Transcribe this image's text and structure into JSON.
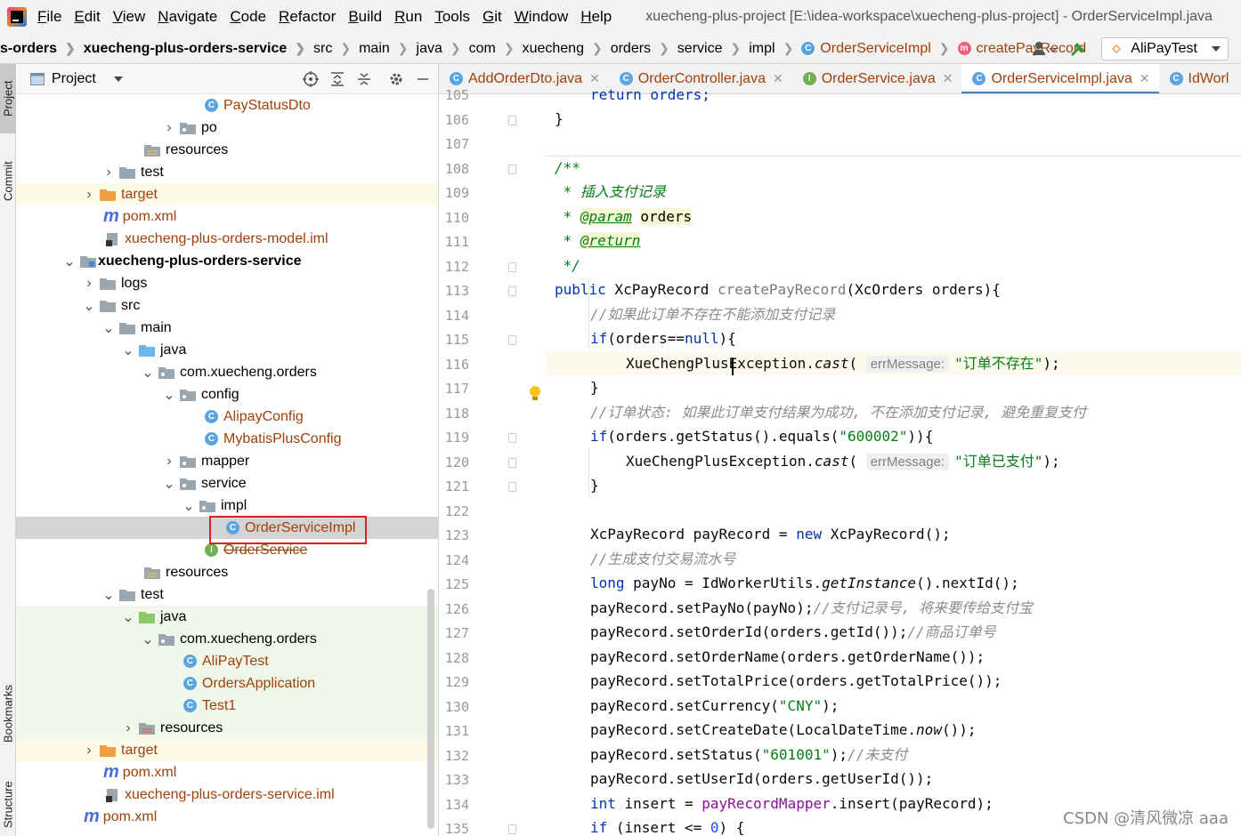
{
  "window": {
    "title": "xuecheng-plus-project [E:\\idea-workspace\\xuecheng-plus-project] - OrderServiceImpl.java"
  },
  "menu": [
    {
      "u": "F",
      "rest": "ile"
    },
    {
      "u": "E",
      "rest": "dit"
    },
    {
      "u": "V",
      "rest": "iew"
    },
    {
      "u": "N",
      "rest": "avigate"
    },
    {
      "u": "C",
      "rest": "ode"
    },
    {
      "u": "R",
      "rest": "efactor"
    },
    {
      "u": "B",
      "rest": "uild"
    },
    {
      "u": "R",
      "rest": "un"
    },
    {
      "u": "T",
      "rest": "ools"
    },
    {
      "u": "G",
      "rest": "it"
    },
    {
      "u": "W",
      "rest": "indow"
    },
    {
      "u": "H",
      "rest": "elp"
    }
  ],
  "breadcrumb": [
    "s-orders",
    "xuecheng-plus-orders-service",
    "src",
    "main",
    "java",
    "com",
    "xuecheng",
    "orders",
    "service",
    "impl",
    "OrderServiceImpl",
    "createPayRecord"
  ],
  "run_config": "AliPayTest",
  "toolstrip": {
    "project": "Project",
    "commit": "Commit",
    "bookmarks": "Bookmarks",
    "structure": "Structure"
  },
  "project_panel": {
    "title": "Project",
    "tree": [
      "PayStatusDto",
      "po",
      "resources",
      "test",
      "target",
      "pom.xml",
      "xuecheng-plus-orders-model.iml",
      "xuecheng-plus-orders-service",
      "logs",
      "src",
      "main",
      "java",
      "com.xuecheng.orders",
      "config",
      "AlipayConfig",
      "MybatisPlusConfig",
      "mapper",
      "service",
      "impl",
      "OrderServiceImpl",
      "OrderService",
      "resources",
      "test",
      "java",
      "com.xuecheng.orders",
      "AliPayTest",
      "OrdersApplication",
      "Test1",
      "resources",
      "target",
      "pom.xml",
      "xuecheng-plus-orders-service.iml",
      "pom.xml"
    ]
  },
  "editor_tabs": [
    {
      "label": "AddOrderDto.java"
    },
    {
      "label": "OrderController.java"
    },
    {
      "label": "OrderService.java"
    },
    {
      "label": "OrderServiceImpl.java"
    },
    {
      "label": "IdWorl"
    }
  ],
  "line_numbers": [
    "105",
    "106",
    "107",
    "108",
    "109",
    "110",
    "111",
    "112",
    "113",
    "114",
    "115",
    "116",
    "117",
    "118",
    "119",
    "120",
    "121",
    "122",
    "123",
    "124",
    "125",
    "126",
    "127",
    "128",
    "129",
    "130",
    "131",
    "132",
    "133",
    "134",
    "135"
  ],
  "code": {
    "l105": "return orders;",
    "l106": "}",
    "l108": "/**",
    "l109": " * 插入支付记录",
    "l110a": " * ",
    "l110b": "@param",
    "l110c": "orders",
    "l111a": " * ",
    "l111b": "@return",
    "l112": " */",
    "l113a": "public",
    "l113b": " XcPayRecord ",
    "l113c": "createPayRecord",
    "l113d": "(XcOrders orders){",
    "l114": "//如果此订单不存在不能添加支付记录",
    "l115a": "if",
    "l115b": "(orders==",
    "l115c": "null",
    "l115d": "){",
    "l116a": "XueChengPlusException.",
    "l116b": "cast",
    "l116c": "( ",
    "l116hint": "errMessage:",
    "l116d": "\"订单不存在\"",
    "l116e": ");",
    "l117": "}",
    "l118": "//订单状态: 如果此订单支付结果为成功, 不在添加支付记录, 避免重复支付",
    "l119a": "if",
    "l119b": "(orders.getStatus().equals(",
    "l119c": "\"600002\"",
    "l119d": ")){",
    "l120a": "XueChengPlusException.",
    "l120b": "cast",
    "l120c": "( ",
    "l120hint": "errMessage:",
    "l120d": "\"订单已支付\"",
    "l120e": ");",
    "l121": "}",
    "l123a": "XcPayRecord payRecord = ",
    "l123b": "new",
    "l123c": " XcPayRecord();",
    "l124": "//生成支付交易流水号",
    "l125a": "long",
    "l125b": " payNo = IdWorkerUtils.",
    "l125c": "getInstance",
    "l125d": "().nextId();",
    "l126a": "payRecord.setPayNo(payNo);",
    "l126b": "//支付记录号, 将来要传给支付宝",
    "l127a": "payRecord.setOrderId(orders.getId());",
    "l127b": "//商品订单号",
    "l128": "payRecord.setOrderName(orders.getOrderName());",
    "l129": "payRecord.setTotalPrice(orders.getTotalPrice());",
    "l130a": "payRecord.setCurrency(",
    "l130b": "\"CNY\"",
    "l130c": ");",
    "l131a": "payRecord.setCreateDate(LocalDateTime.",
    "l131b": "now",
    "l131c": "());",
    "l132a": "payRecord.setStatus(",
    "l132b": "\"601001\"",
    "l132c": ");",
    "l132d": "//未支付",
    "l133": "payRecord.setUserId(orders.getUserId());",
    "l134a": "int",
    "l134b": " insert = ",
    "l134c": "payRecordMapper",
    "l134d": ".insert(payRecord);",
    "l135a": "if",
    "l135b": " (insert <= ",
    "l135c": "0",
    "l135d": ") {"
  },
  "watermark": "CSDN @清风微凉 aaa",
  "colors": {
    "accent": "#4083c9",
    "selection_box": "#e02020",
    "keyword": "#0033b3",
    "string": "#067d17"
  }
}
